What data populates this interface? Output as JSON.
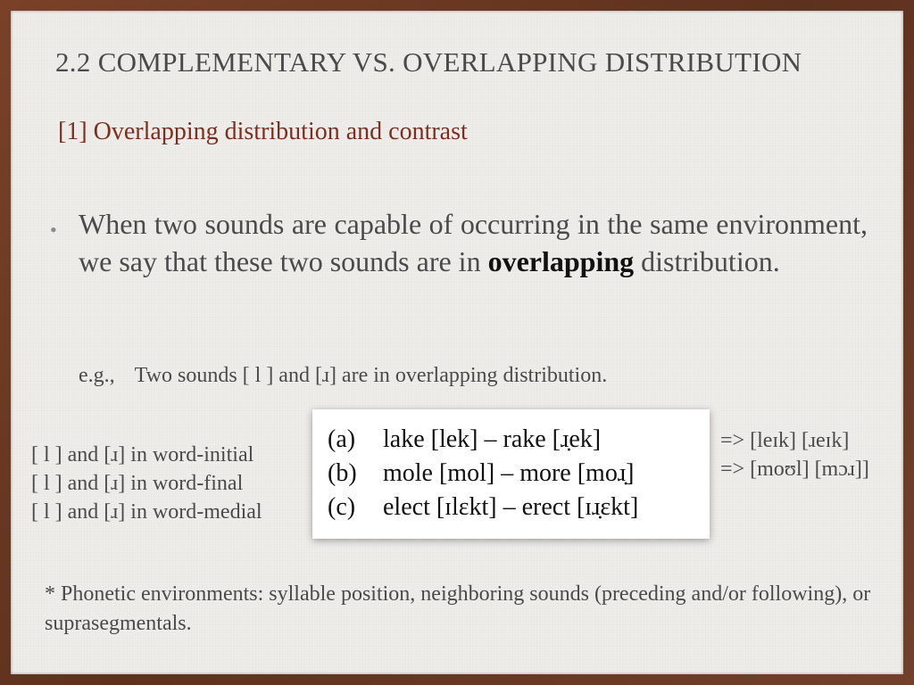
{
  "slide": {
    "title": "2.2 COMPLEMENTARY VS. OVERLAPPING DISTRIBUTION",
    "subtitle": "[1] Overlapping distribution and contrast",
    "bullet": {
      "text_before": "When two sounds are capable of occurring in the same environment, we say that these two sounds are in ",
      "bold": "overlapping",
      "text_after": " distribution."
    },
    "example": {
      "prefix": "e.g.,",
      "text": "Two sounds [ l ] and [ɹ] are in overlapping distribution."
    },
    "environments": [
      "[ l ] and [ɹ] in word-initial",
      "[ l ] and [ɹ] in word-final",
      "[ l ] and [ɹ] in word-medial"
    ],
    "pairs": [
      {
        "label": "(a)",
        "text": "lake [lek] – rake [ɹ̣ek]"
      },
      {
        "label": "(b)",
        "text": "mole [mol] – more [moɹ̣]"
      },
      {
        "label": "(c)",
        "text": "elect [ɪlɛkt] – erect [ɪɹ̣ɛkt]"
      }
    ],
    "transcriptions": [
      "=> [leɪk] [ɹeɪk]",
      "=> [moʊl] [mɔɹ]]"
    ],
    "note": "* Phonetic environments: syllable position, neighboring sounds (preceding and/or following), or suprasegmentals."
  }
}
